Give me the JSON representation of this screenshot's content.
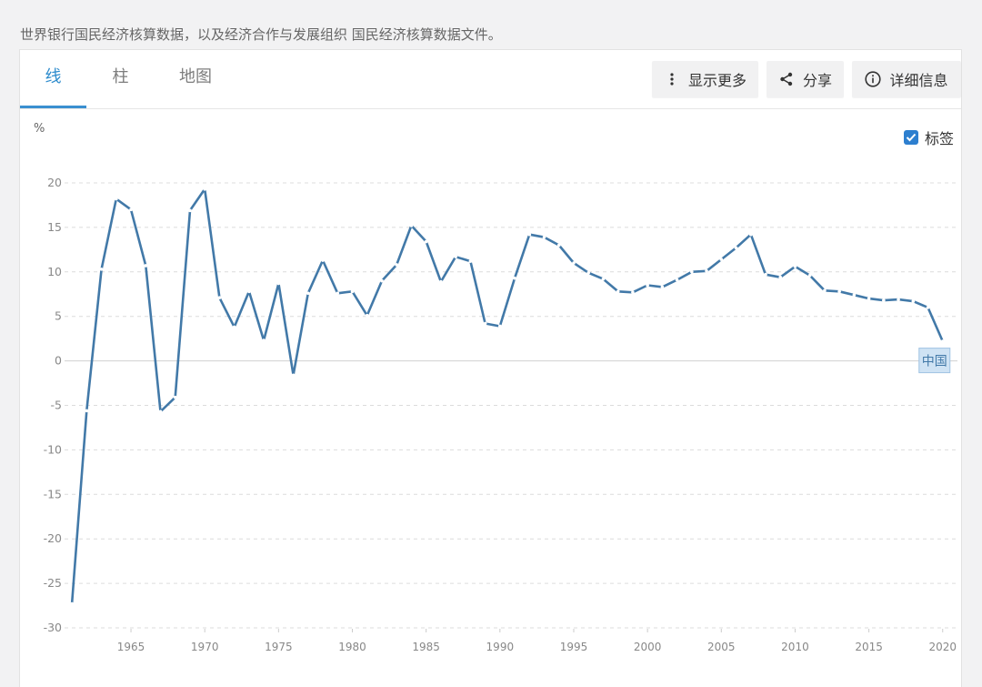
{
  "source_note": "世界银行国民经济核算数据，以及经济合作与发展组织 国民经济核算数据文件。",
  "tabs": [
    {
      "label": "线",
      "active": true
    },
    {
      "label": "柱",
      "active": false
    },
    {
      "label": "地图",
      "active": false
    }
  ],
  "toolbar": {
    "show_more": "显示更多",
    "share": "分享",
    "details": "详细信息"
  },
  "label_toggle": {
    "label": "标签",
    "checked": true
  },
  "colors": {
    "line": "#4279a8",
    "accent": "#2e8ccd",
    "grid": "#dcdcdc",
    "zero_line": "#d0d0d0",
    "series_label_bg": "#cfe3f4",
    "series_label_text": "#4279a8"
  },
  "chart_data": {
    "type": "line",
    "unit_label": "%",
    "ylim": [
      -30,
      20
    ],
    "yticks": [
      "20",
      "15",
      "10",
      "5",
      "0",
      "-5",
      "-10",
      "-15",
      "-20",
      "-25",
      "-30"
    ],
    "ytick_values": [
      20,
      15,
      10,
      5,
      0,
      -5,
      -10,
      -15,
      -20,
      -25,
      -30
    ],
    "xticks": [
      "1965",
      "1970",
      "1975",
      "1980",
      "1985",
      "1990",
      "1995",
      "2000",
      "2005",
      "2010",
      "2015",
      "2020"
    ],
    "xtick_values": [
      1965,
      1970,
      1975,
      1980,
      1985,
      1990,
      1995,
      2000,
      2005,
      2010,
      2015,
      2020
    ],
    "xlim": [
      1960.5,
      2021
    ],
    "grid": true,
    "series": [
      {
        "name": "中国",
        "x": [
          1961,
          1962,
          1963,
          1964,
          1965,
          1966,
          1967,
          1968,
          1969,
          1970,
          1971,
          1972,
          1973,
          1974,
          1975,
          1976,
          1977,
          1978,
          1979,
          1980,
          1981,
          1982,
          1983,
          1984,
          1985,
          1986,
          1987,
          1988,
          1989,
          1990,
          1991,
          1992,
          1993,
          1994,
          1995,
          1996,
          1997,
          1998,
          1999,
          2000,
          2001,
          2002,
          2003,
          2004,
          2005,
          2006,
          2007,
          2008,
          2009,
          2010,
          2011,
          2012,
          2013,
          2014,
          2015,
          2016,
          2017,
          2018,
          2019,
          2020
        ],
        "values": [
          -27.3,
          -5.6,
          10.3,
          18.2,
          17.0,
          10.7,
          -5.7,
          -4.1,
          16.9,
          19.3,
          7.1,
          3.8,
          7.8,
          2.3,
          8.7,
          -1.6,
          7.6,
          11.3,
          7.6,
          7.8,
          5.1,
          9.0,
          10.8,
          15.2,
          13.4,
          8.9,
          11.7,
          11.2,
          4.2,
          3.9,
          9.3,
          14.2,
          13.9,
          13.0,
          11.0,
          9.9,
          9.2,
          7.8,
          7.7,
          8.5,
          8.3,
          9.1,
          10.0,
          10.1,
          11.4,
          12.7,
          14.2,
          9.7,
          9.4,
          10.6,
          9.6,
          7.9,
          7.8,
          7.4,
          7.0,
          6.8,
          6.9,
          6.7,
          6.0,
          2.2
        ]
      }
    ]
  }
}
